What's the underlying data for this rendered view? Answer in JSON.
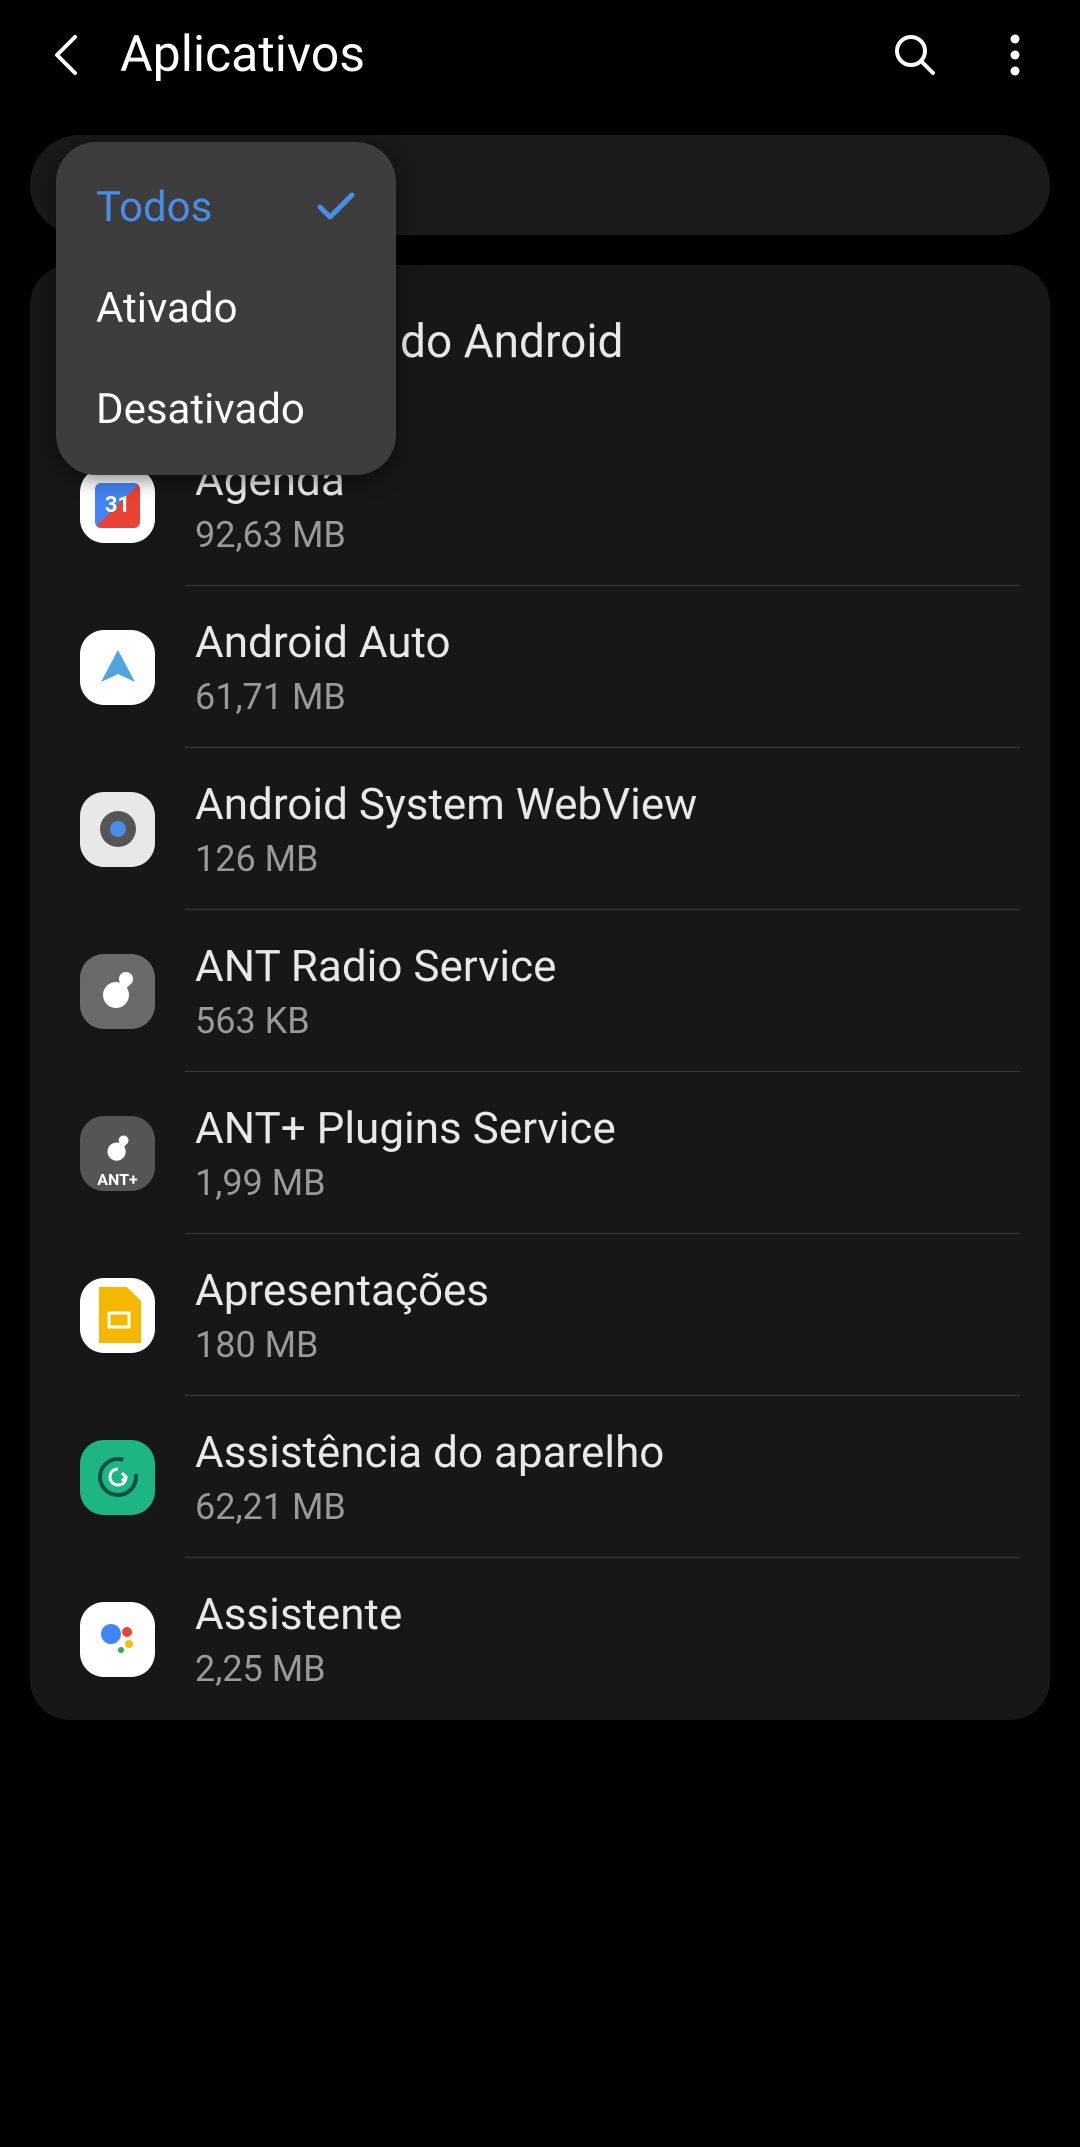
{
  "header": {
    "title": "Aplicativos"
  },
  "dropdown": {
    "items": [
      {
        "label": "Todos",
        "selected": true
      },
      {
        "label": "Ativado",
        "selected": false
      },
      {
        "label": "Desativado",
        "selected": false
      }
    ]
  },
  "card": {
    "header_partial": "do Android"
  },
  "apps": [
    {
      "name": "Agenda",
      "size": "92,63 MB",
      "icon": "agenda"
    },
    {
      "name": "Android Auto",
      "size": "61,71 MB",
      "icon": "auto"
    },
    {
      "name": "Android System WebView",
      "size": "126 MB",
      "icon": "webview"
    },
    {
      "name": "ANT Radio Service",
      "size": "563 KB",
      "icon": "ant"
    },
    {
      "name": "ANT+ Plugins Service",
      "size": "1,99 MB",
      "icon": "antplus"
    },
    {
      "name": "Apresentações",
      "size": "180 MB",
      "icon": "apres"
    },
    {
      "name": "Assistência do aparelho",
      "size": "62,21 MB",
      "icon": "assist"
    },
    {
      "name": "Assistente",
      "size": "2,25 MB",
      "icon": "assistente"
    }
  ]
}
